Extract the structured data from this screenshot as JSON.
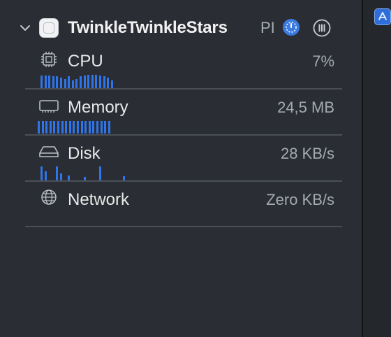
{
  "process": {
    "name": "TwinkleTwinkleStars",
    "pid_label": "PI",
    "chevron_icon": "chevron-down-icon",
    "app_icon": "app-icon",
    "badge_icon": "debug-gauge-icon",
    "pause_icon": "pause-circle-icon"
  },
  "metrics": [
    {
      "label": "CPU",
      "value": "7%",
      "icon": "cpu-chip-icon",
      "sparkline": [
        0.8,
        0.8,
        0.8,
        0.75,
        0.75,
        0.7,
        0.6,
        0.75,
        0.5,
        0.6,
        0.75,
        0.8,
        0.85,
        0.85,
        0.85,
        0.8,
        0.75,
        0.7,
        0.5
      ]
    },
    {
      "label": "Memory",
      "value": "24,5 MB",
      "icon": "memory-module-icon",
      "sparkline": [
        0.9,
        0.9,
        0.9,
        0.9,
        0.9,
        0.9,
        0.9,
        0.9,
        0.9,
        0.9,
        0.9,
        0.9,
        0.9,
        0.9,
        0.9,
        0.9,
        0.9,
        0.9,
        0.9
      ]
    },
    {
      "label": "Disk",
      "value": "28 KB/s",
      "icon": "disk-drive-icon",
      "sparkline": [
        1.0,
        0.65,
        0,
        0,
        1.0,
        0.5,
        0,
        0.35,
        0,
        0,
        0,
        0.25,
        0,
        0,
        0,
        1.0,
        0,
        0,
        0,
        0,
        0,
        0.3
      ]
    },
    {
      "label": "Network",
      "value": "Zero KB/s",
      "icon": "globe-icon",
      "sparkline": []
    }
  ],
  "colors": {
    "accent": "#2f74e8",
    "background": "#2a2e34",
    "divider": "#4a4e55"
  }
}
